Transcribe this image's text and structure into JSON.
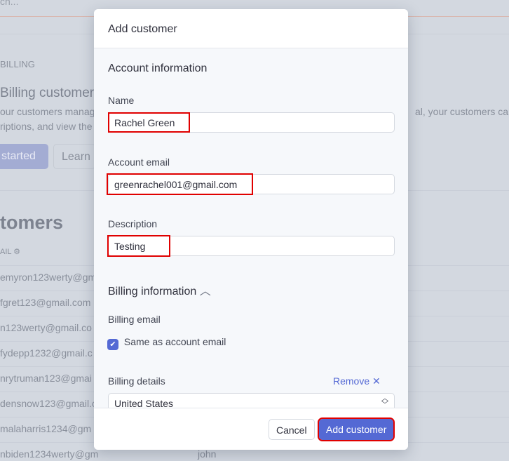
{
  "background": {
    "search_placeholder": "ch...",
    "section_label": "BILLING",
    "heading": "Billing customer",
    "desc_line1": "our customers manag",
    "desc_line1_right": "al, your customers can",
    "desc_line2": "riptions, and view the",
    "get_started": "started",
    "learn": "Learn",
    "customers_title": "tomers",
    "email_column": "AIL",
    "rows": [
      "emyron123werty@gm",
      "fgret123@gmail.com",
      "n123werty@gmail.co",
      "fydepp1232@gmail.c",
      "nrytruman123@gmai",
      "densnow123@gmail.c",
      "malaharris1234@gm",
      "nbiden1234werty@gm"
    ],
    "last_row_name": "john"
  },
  "modal": {
    "title": "Add customer",
    "account_section": "Account information",
    "name_label": "Name",
    "name_value": "Rachel Green",
    "email_label": "Account email",
    "email_value": "greenrachel001@gmail.com",
    "description_label": "Description",
    "description_value": "Testing",
    "billing_section": "Billing information",
    "billing_email_label": "Billing email",
    "same_as_account": "Same as account email",
    "same_as_account_checked": true,
    "billing_details_label": "Billing details",
    "remove_label": "Remove",
    "country_value": "United States",
    "cancel_label": "Cancel",
    "submit_label": "Add customer",
    "accent_color": "#5469d4",
    "highlight_color": "#e00000"
  }
}
